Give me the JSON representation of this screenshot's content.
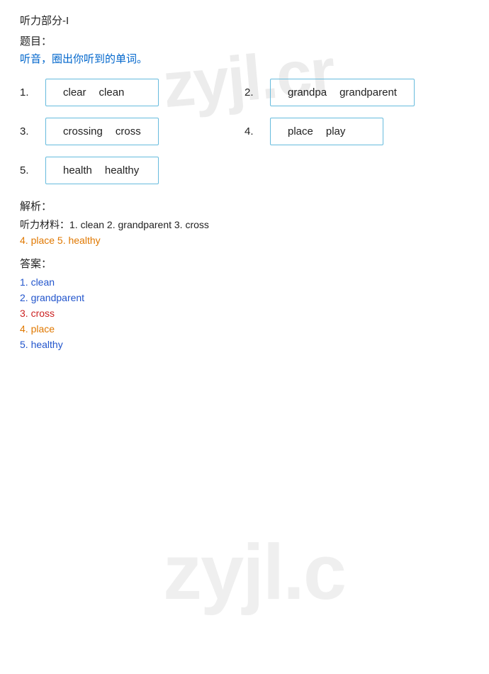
{
  "header": {
    "section": "听力部分-I",
    "question_label": "题目：",
    "instruction": "听音，圈出你听到的单词。"
  },
  "questions": [
    {
      "num": "1.",
      "words": [
        "clear",
        "clean"
      ]
    },
    {
      "num": "2.",
      "words": [
        "grandpa",
        "grandparent"
      ]
    },
    {
      "num": "3.",
      "words": [
        "crossing",
        "cross"
      ]
    },
    {
      "num": "4.",
      "words": [
        "place",
        "play"
      ]
    },
    {
      "num": "5.",
      "words": [
        "health",
        "healthy"
      ]
    }
  ],
  "analysis": {
    "title": "解析：",
    "listening_material_label": "听力材料：",
    "listening_material": "1. clean 2. grandparent 3. cross",
    "line2": "4. place 5. healthy",
    "answer_title": "答案：",
    "answers": [
      {
        "text": "1. clean",
        "color": "blue"
      },
      {
        "text": "2. grandparent",
        "color": "blue"
      },
      {
        "text": "3. cross",
        "color": "red"
      },
      {
        "text": "4. place",
        "color": "orange"
      },
      {
        "text": "5. healthy",
        "color": "blue"
      }
    ]
  },
  "watermark": "zyjl.cr"
}
